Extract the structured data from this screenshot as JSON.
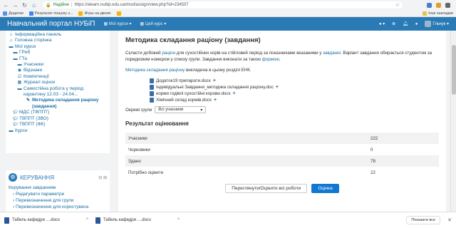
{
  "browser": {
    "secure_label": "Надійне",
    "url": "https://elearn.nubip.edu.ua/mod/assign/view.php?id=234507",
    "bookmarks": [
      "Додатки",
      "Результат пошуку з...",
      "Игры на двоих"
    ],
    "bookmarks_other": "Інші закладки"
  },
  "navbar": {
    "site_title": "Навчальний портал НУБіП",
    "menu_my_courses": "Мої курси ▾",
    "menu_this_course": "Цей курс ▾",
    "user_name": "Гльчук ▾"
  },
  "sidebar": {
    "nav_items": [
      {
        "label": "Інформаційна панель",
        "icon": "home-icon"
      },
      {
        "label": "Головна сторінка",
        "icon": "home-icon"
      },
      {
        "label": "Мої курси",
        "icon": "courses-icon"
      },
      {
        "label": "ГРиб",
        "icon": "folder-icon"
      },
      {
        "label": "ГТа",
        "icon": "folder-icon"
      },
      {
        "label": "Учасники",
        "icon": "folder-icon"
      },
      {
        "label": "Відзнаки",
        "icon": "badge-icon"
      },
      {
        "label": "Компетенції",
        "icon": "check-icon"
      },
      {
        "label": "Журнал оцінок",
        "icon": "grades-icon"
      },
      {
        "label": "Самостійна робота у період карантину 12.03 - 24.04...",
        "icon": "folder-icon"
      },
      {
        "label": "Методика складання раціону (завдання)",
        "icon": "assign-icon"
      },
      {
        "label": "МДС (ТВППТ)",
        "icon": "course-icon"
      },
      {
        "label": "ТВППТ (ЗВО)",
        "icon": "course-icon"
      },
      {
        "label": "ТВППТ (ФК)",
        "icon": "course-icon"
      },
      {
        "label": "Курси",
        "icon": "folder-icon"
      }
    ],
    "admin_title": "КЕРУВАННЯ",
    "admin_items": [
      "Керування завданням",
      "› Редагувати параметри",
      "› Перевизначення для групи",
      "› Перевизначення для користувача"
    ]
  },
  "main": {
    "title": "Методика складання раціону (завдання)",
    "intro_part1": "Скласти добовий ",
    "intro_link1": "раціон",
    "intro_part2": " для сухостійних корів на стійловий період за показниками вказаними у ",
    "intro_link2": "завданні",
    "intro_part3": ". Варіант завдання обирається студентом за порядковим номером у списку групи. Завдання виконати за такою ",
    "intro_link3": "формою",
    "intro_part4": ".",
    "method_link": "Методика складання раціону",
    "method_rest": " викладена в цьому розділі ЕНК.",
    "files": [
      "Додаток19 препарати.docx",
      "Індивідуальні Завдання_методика складання раціону.doc",
      "норми годівлі сухостійні корови.docx",
      "Хімічний склад кормів.docx"
    ],
    "groups_label": "Окремі групи",
    "groups_value": "Всі учасники",
    "grading_title": "Результат оцінювання",
    "grading_rows": [
      {
        "label": "Учасники",
        "value": "222"
      },
      {
        "label": "Чорновики",
        "value": "0"
      },
      {
        "label": "Здано",
        "value": "78"
      },
      {
        "label": "Потрібно оцінити",
        "value": "22"
      }
    ],
    "view_all_label": "Переглянути/Оцінити всі роботи",
    "grade_label": "Оцінка"
  },
  "downloads": {
    "items": [
      "Табель кафедри ....docx",
      "Табель кафедри ....docx"
    ],
    "show_all": "Показати все"
  }
}
